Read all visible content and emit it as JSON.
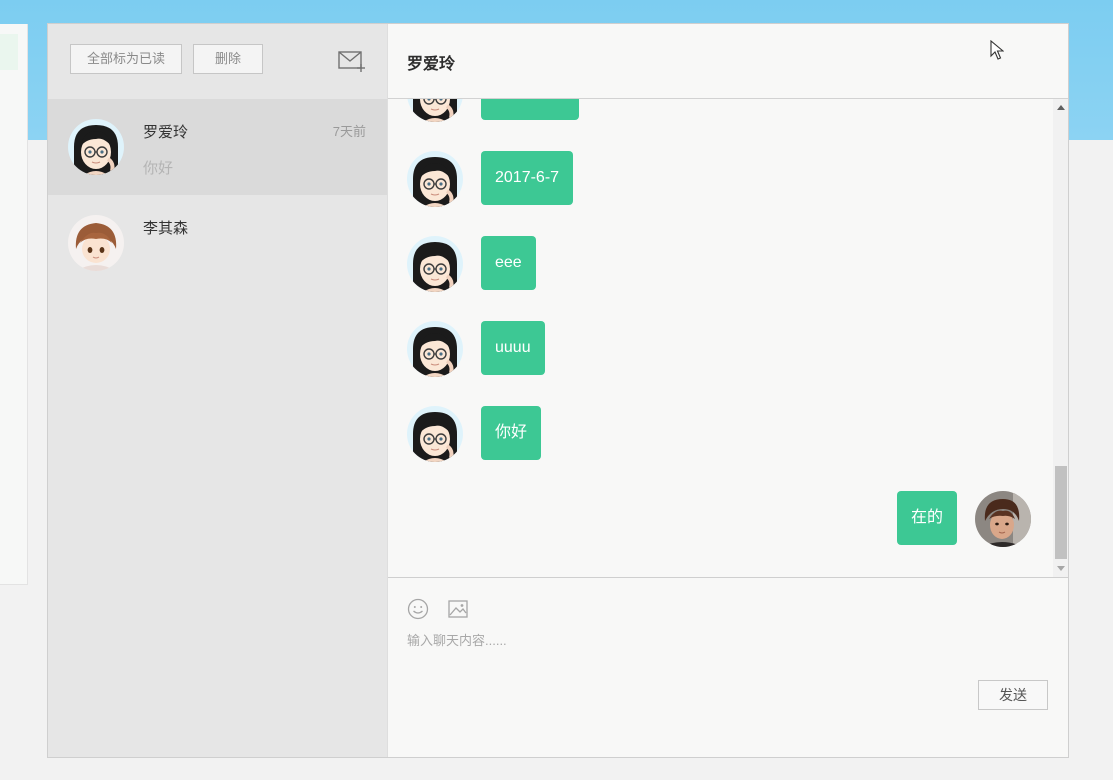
{
  "toolbar": {
    "mark_all_read_label": "全部标为已读",
    "delete_label": "删除"
  },
  "conversations": [
    {
      "name": "罗爱玲",
      "time": "7天前",
      "preview": "你好",
      "active": true
    },
    {
      "name": "李其森",
      "time": "",
      "preview": "",
      "active": false
    }
  ],
  "chat": {
    "title": "罗爱玲",
    "messages": [
      {
        "text": "",
        "from": "other"
      },
      {
        "text": "2017-6-7",
        "from": "other"
      },
      {
        "text": "eee",
        "from": "other"
      },
      {
        "text": "uuuu",
        "from": "other"
      },
      {
        "text": "你好",
        "from": "other"
      },
      {
        "text": "在的",
        "from": "me"
      }
    ]
  },
  "composer": {
    "placeholder": "输入聊天内容......",
    "send_label": "发送"
  },
  "colors": {
    "accent": "#3dc894",
    "sidebar_bg": "#e6e6e6",
    "sidebar_active": "#dadada",
    "background_top": "#7ccdf1"
  },
  "icons": [
    "compose-mail-icon",
    "emoji-icon",
    "image-icon",
    "scroll-up-icon",
    "scroll-down-icon",
    "mouse-cursor-icon"
  ]
}
